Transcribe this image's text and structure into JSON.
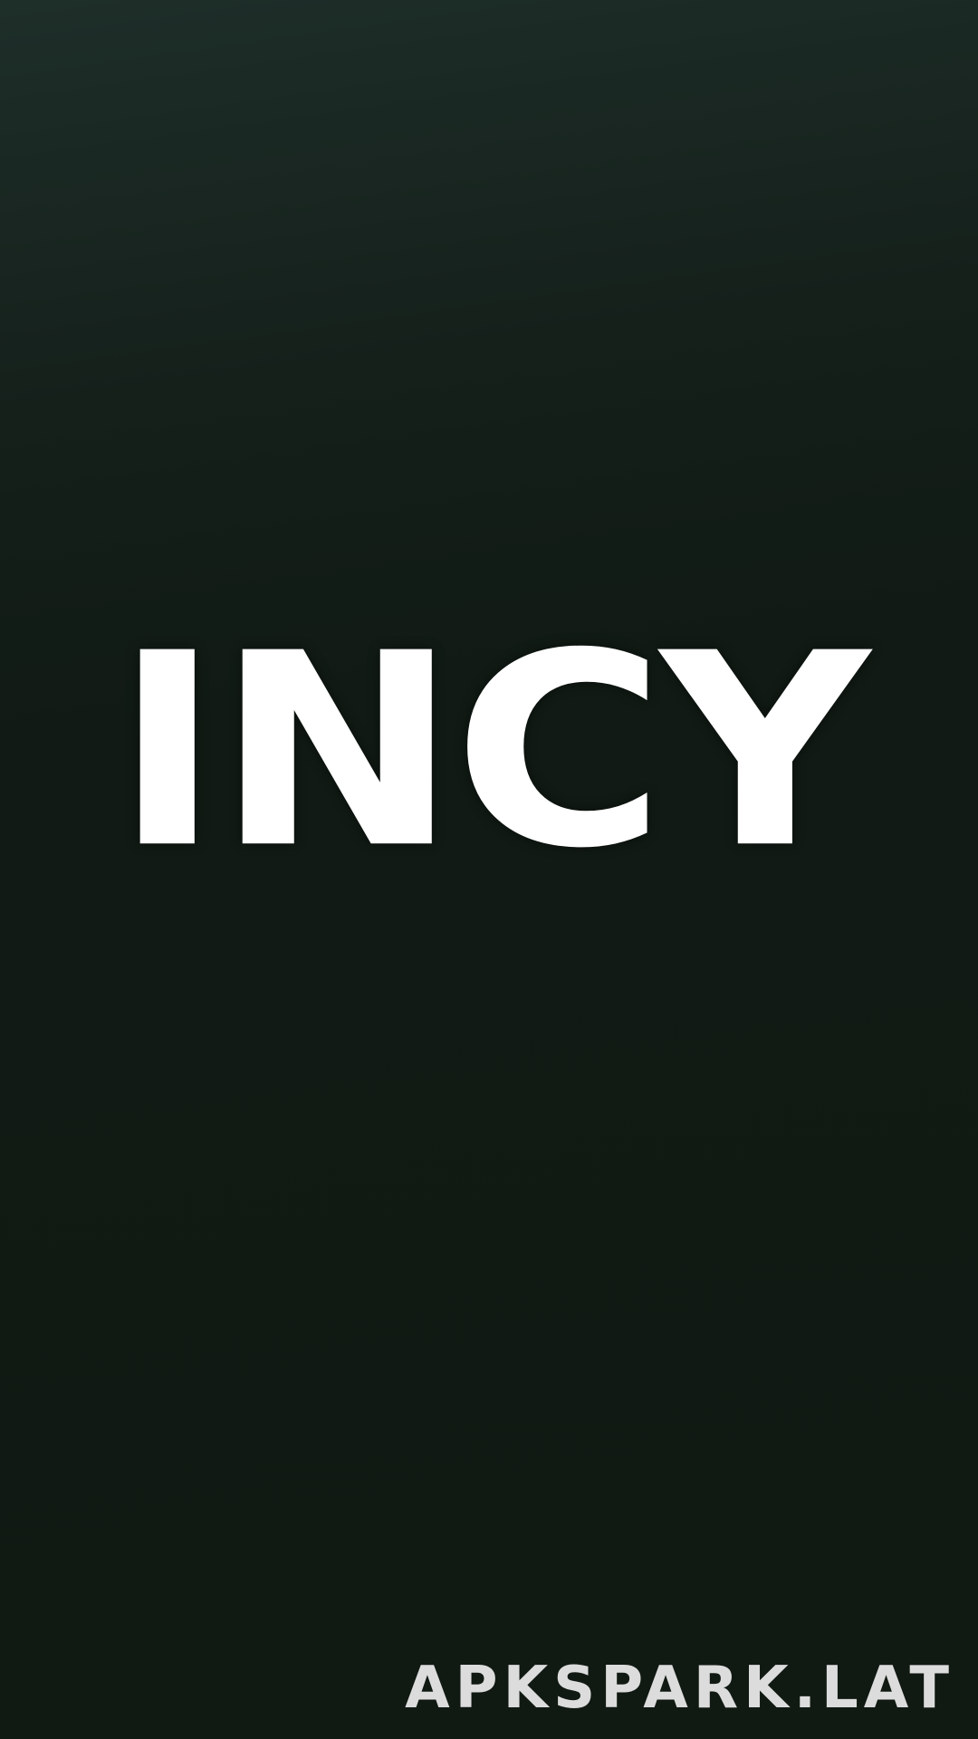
{
  "app": {
    "logo_text": "INCY"
  },
  "watermark": {
    "text": "APKSPARK.LAT"
  },
  "colors": {
    "background_top": "#1e2e29",
    "background_bottom": "#101912",
    "logo": "#ffffff",
    "watermark": "#dcdcdc"
  }
}
